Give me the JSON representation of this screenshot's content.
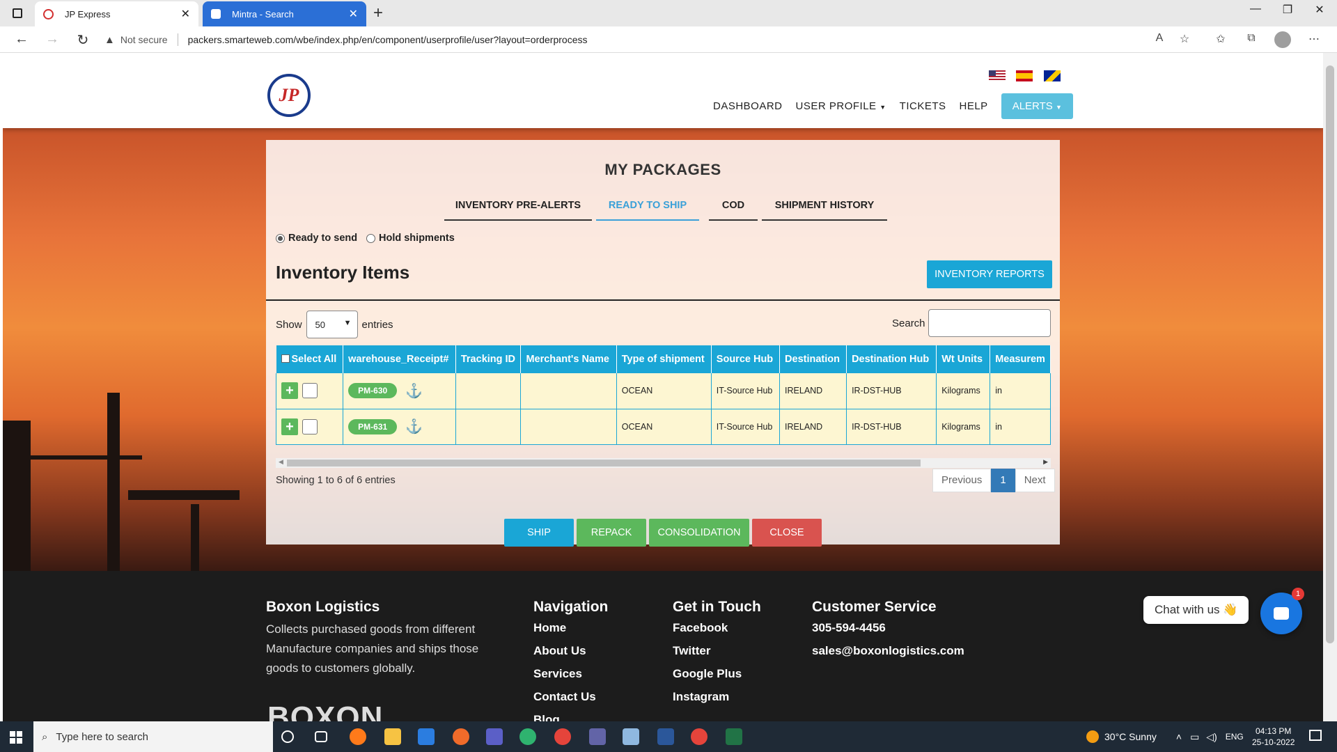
{
  "browser": {
    "tabs": [
      {
        "title": "JP Express",
        "active": true
      },
      {
        "title": "Mintra - Search",
        "active": false
      }
    ],
    "security_label": "Not secure",
    "url": "packers.smarteweb.com/wbe/index.php/en/component/userprofile/user?layout=orderprocess"
  },
  "header": {
    "logo_text": "JP",
    "nav": {
      "dashboard": "DASHBOARD",
      "user_profile": "USER PROFILE",
      "tickets": "TICKETS",
      "help": "HELP",
      "alerts": "ALERTS"
    }
  },
  "panel": {
    "title": "MY PACKAGES",
    "tabs": [
      "INVENTORY PRE-ALERTS",
      "READY TO SHIP",
      "COD",
      "SHIPMENT HISTORY"
    ],
    "active_tab": "READY TO SHIP",
    "radio_ready": "Ready to send",
    "radio_hold": "Hold shipments",
    "inventory_title": "Inventory Items",
    "inventory_reports": "INVENTORY REPORTS",
    "show_label": "Show",
    "entries_value": "50",
    "entries_label": "entries",
    "search_label": "Search",
    "table": {
      "headers": [
        "Select All",
        "warehouse_Receipt#",
        "Tracking ID",
        "Merchant's Name",
        "Type of shipment",
        "Source Hub",
        "Destination",
        "Destination Hub",
        "Wt Units",
        "Measurem"
      ],
      "rows": [
        {
          "receipt": "PM-630",
          "tracking": "",
          "merchant": "",
          "type": "OCEAN",
          "source_hub": "IT-Source Hub",
          "destination": "IRELAND",
          "destination_hub": "IR-DST-HUB",
          "wt_units": "Kilograms",
          "measure": "in"
        },
        {
          "receipt": "PM-631",
          "tracking": "",
          "merchant": "",
          "type": "OCEAN",
          "source_hub": "IT-Source Hub",
          "destination": "IRELAND",
          "destination_hub": "IR-DST-HUB",
          "wt_units": "Kilograms",
          "measure": "in"
        }
      ]
    },
    "showing": "Showing 1 to 6 of 6 entries",
    "pager": {
      "previous": "Previous",
      "current": "1",
      "next": "Next"
    },
    "actions": {
      "ship": "SHIP",
      "repack": "REPACK",
      "consolidation": "CONSOLIDATION",
      "close": "CLOSE"
    }
  },
  "footer": {
    "company": {
      "title": "Boxon Logistics",
      "text": "Collects purchased goods from different Manufacture companies and ships those goods to customers globally.",
      "logo_text": "BOXON"
    },
    "navigation": {
      "title": "Navigation",
      "links": [
        "Home",
        "About Us",
        "Services",
        "Contact Us",
        "Blog"
      ]
    },
    "get_in_touch": {
      "title": "Get in Touch",
      "links": [
        "Facebook",
        "Twitter",
        "Google Plus",
        "Instagram"
      ]
    },
    "customer_service": {
      "title": "Customer Service",
      "phone": "305-594-4456",
      "email": "sales@boxonlogistics.com"
    }
  },
  "chat": {
    "label": "Chat with us 👋",
    "badge": "1"
  },
  "taskbar": {
    "search_placeholder": "Type here to search",
    "weather": "30°C  Sunny",
    "language": "ENG",
    "time": "04:13 PM",
    "date": "25-10-2022"
  },
  "colors": {
    "accent": "#1aa6d6",
    "success": "#5cb85c",
    "danger": "#d9534f",
    "row_bg": "#fdf6d2"
  }
}
